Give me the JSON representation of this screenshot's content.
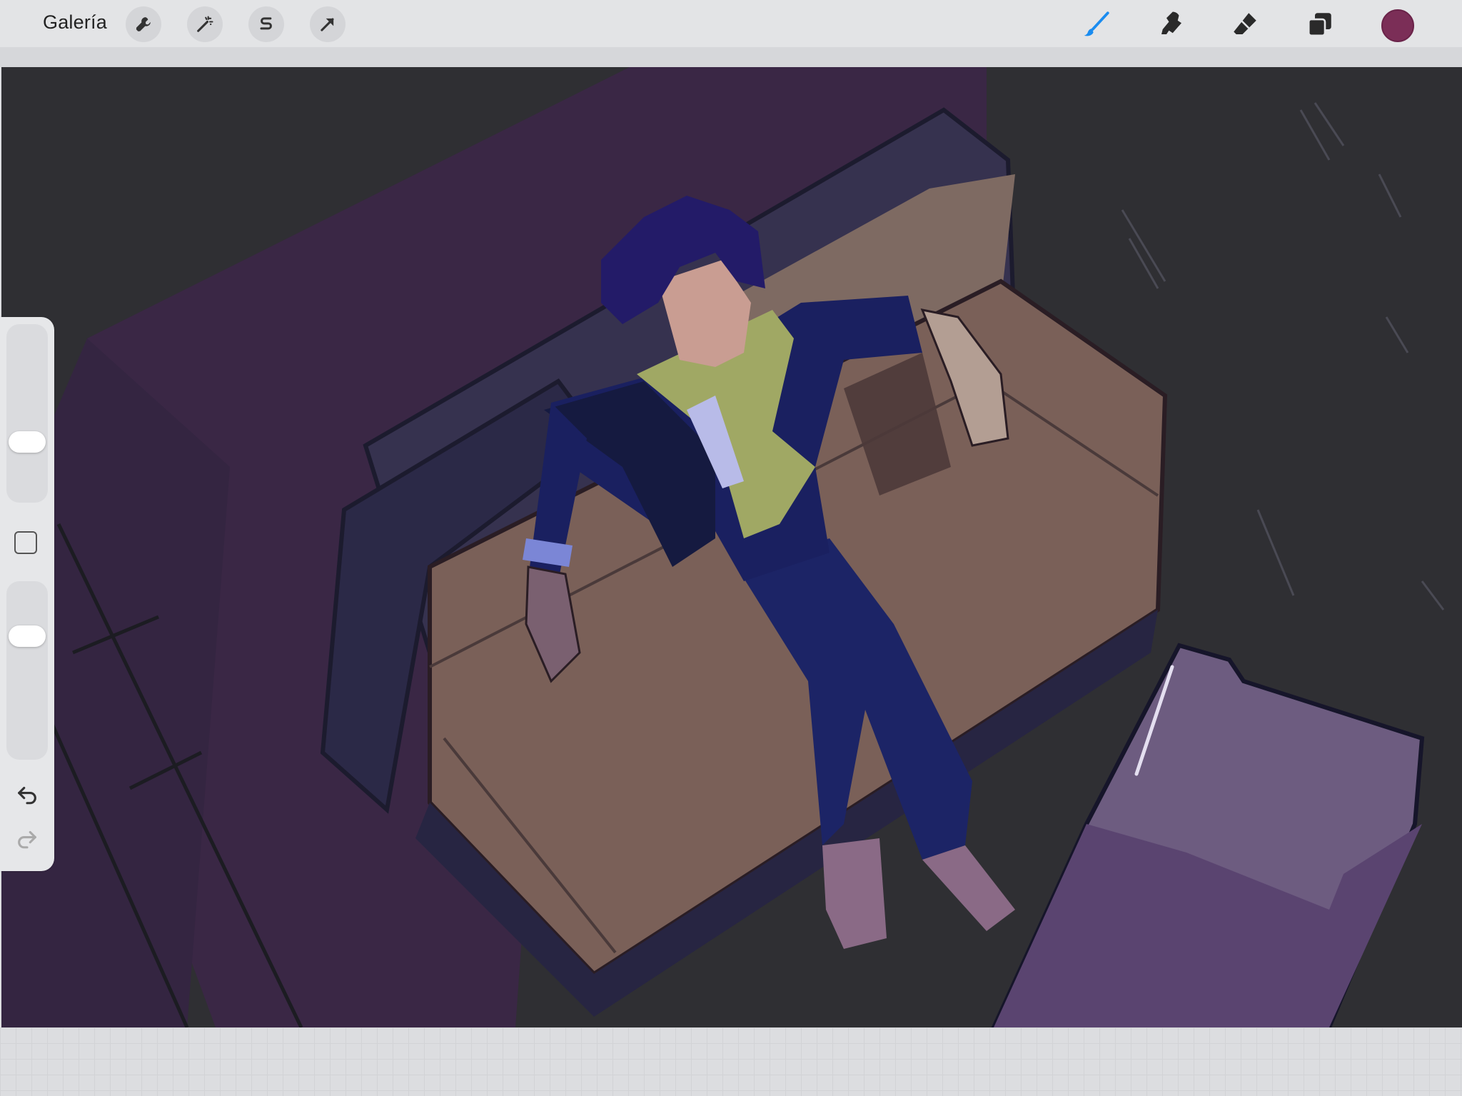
{
  "app": {
    "gallery_label": "Galería",
    "current_color": "#7b2e57"
  },
  "toolbar_left": [
    {
      "name": "actions",
      "icon": "wrench-icon"
    },
    {
      "name": "adjustments",
      "icon": "magic-wand-icon"
    },
    {
      "name": "selection",
      "icon": "selection-s-icon"
    },
    {
      "name": "transform",
      "icon": "transform-arrow-icon"
    }
  ],
  "toolbar_right": [
    {
      "name": "brush",
      "icon": "brush-icon",
      "active": true,
      "color": "#1a8cf0"
    },
    {
      "name": "smudge",
      "icon": "smudge-icon"
    },
    {
      "name": "eraser",
      "icon": "eraser-icon"
    },
    {
      "name": "layers",
      "icon": "layers-icon"
    }
  ],
  "sidebar": {
    "brush_size_level": 0.32,
    "opacity_level": 0.72,
    "modify_button": "square-icon",
    "undo": "undo-icon",
    "redo": "redo-icon"
  },
  "canvas": {
    "background": "#2f2f33",
    "artwork": "illustration-of-man-lying-on-couch"
  }
}
